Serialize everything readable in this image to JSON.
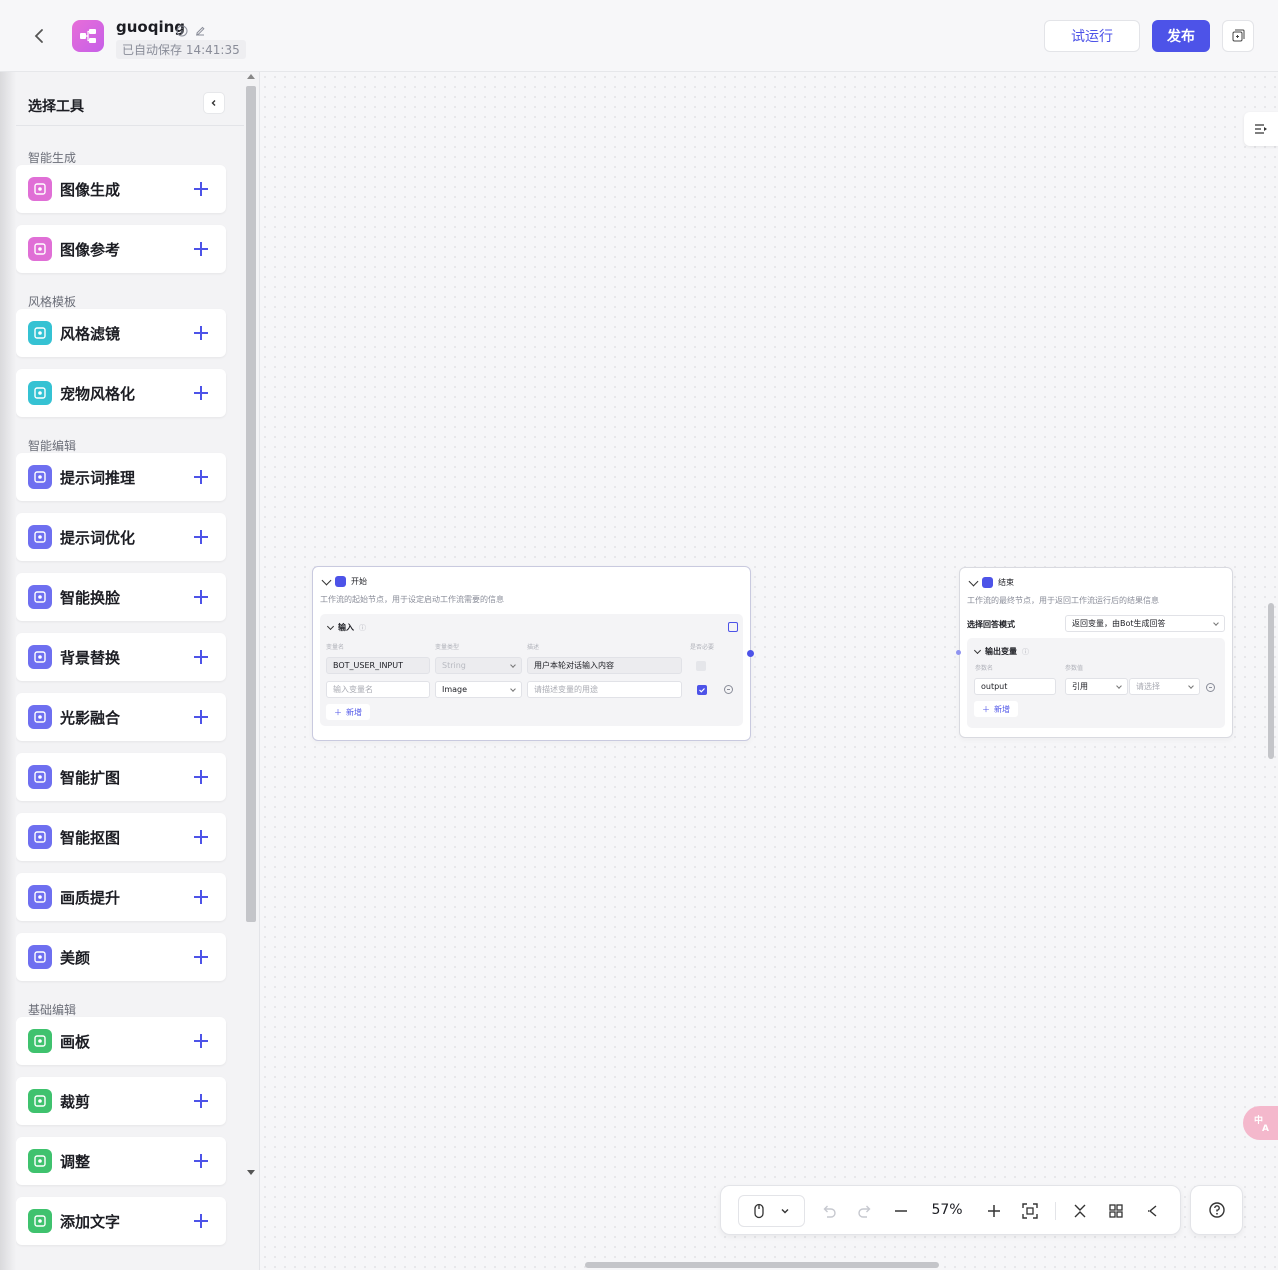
{
  "header": {
    "app_name": "guoqing",
    "autosave": "已自动保存 14:41:35",
    "trial_run_label": "试运行",
    "publish_label": "发布"
  },
  "sidebar": {
    "title": "选择工具",
    "sections": [
      {
        "label": "智能生成",
        "items": [
          {
            "label": "图像生成",
            "icon": "image-generate-icon",
            "color": "#e06fd6"
          },
          {
            "label": "图像参考",
            "icon": "image-reference-icon",
            "color": "#e06fd6"
          }
        ]
      },
      {
        "label": "风格模板",
        "items": [
          {
            "label": "风格滤镜",
            "icon": "style-filter-icon",
            "color": "#35c2d3"
          },
          {
            "label": "宠物风格化",
            "icon": "pet-style-icon",
            "color": "#35c2d3"
          }
        ]
      },
      {
        "label": "智能编辑",
        "items": [
          {
            "label": "提示词推理",
            "icon": "bulb-icon",
            "color": "#6e6ff0"
          },
          {
            "label": "提示词优化",
            "icon": "list-icon",
            "color": "#6e6ff0"
          },
          {
            "label": "智能换脸",
            "icon": "face-icon",
            "color": "#6e6ff0"
          },
          {
            "label": "背景替换",
            "icon": "background-icon",
            "color": "#6e6ff0"
          },
          {
            "label": "光影融合",
            "icon": "light-icon",
            "color": "#6e6ff0"
          },
          {
            "label": "智能扩图",
            "icon": "expand-icon",
            "color": "#6e6ff0"
          },
          {
            "label": "智能抠图",
            "icon": "cutout-icon",
            "color": "#6e6ff0"
          },
          {
            "label": "画质提升",
            "icon": "hd-icon",
            "color": "#6e6ff0"
          },
          {
            "label": "美颜",
            "icon": "beauty-icon",
            "color": "#6e6ff0"
          }
        ]
      },
      {
        "label": "基础编辑",
        "items": [
          {
            "label": "画板",
            "icon": "canvas-icon",
            "color": "#3fc26e"
          },
          {
            "label": "裁剪",
            "icon": "crop-icon",
            "color": "#3fc26e"
          },
          {
            "label": "调整",
            "icon": "adjust-icon",
            "color": "#3fc26e"
          },
          {
            "label": "添加文字",
            "icon": "text-icon",
            "color": "#3fc26e"
          }
        ]
      }
    ]
  },
  "start_node": {
    "title": "开始",
    "description": "工作流的起始节点，用于设定启动工作流需要的信息",
    "input_label": "输入",
    "columns": [
      "变量名",
      "变量类型",
      "描述",
      "是否必要"
    ],
    "rows": [
      {
        "name": "BOT_USER_INPUT",
        "type": "String",
        "desc": "用户本轮对话输入内容"
      },
      {
        "name_placeholder": "输入变量名",
        "type": "Image",
        "desc_placeholder": "请描述变量的用途"
      }
    ],
    "add_label": "新增"
  },
  "end_node": {
    "title": "结束",
    "description": "工作流的最终节点，用于返回工作流运行后的结果信息",
    "answer_mode_label": "选择回答模式",
    "answer_mode_value": "返回变量，由Bot生成回答",
    "output_label": "输出变量",
    "columns": [
      "参数名",
      "参数值"
    ],
    "row": {
      "name": "output",
      "source": "引用",
      "value_placeholder": "请选择"
    },
    "add_label": "新增"
  },
  "toolbar": {
    "zoom": "57%"
  },
  "colors": {
    "accent": "#4d53e8"
  }
}
